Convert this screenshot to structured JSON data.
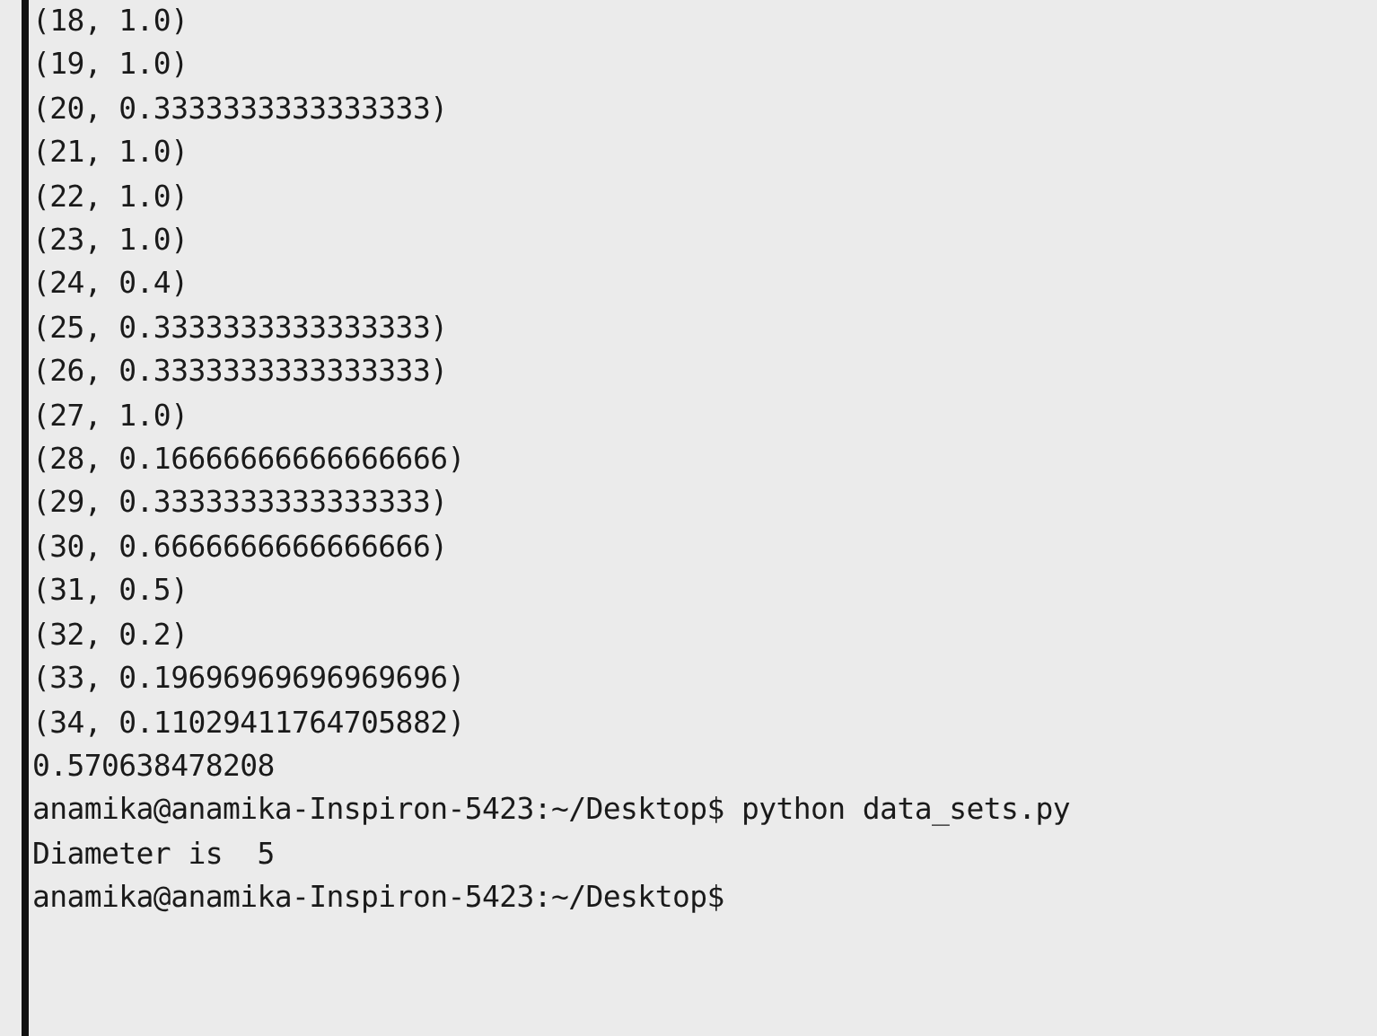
{
  "terminal": {
    "lines": [
      "(18, 1.0)",
      "(19, 1.0)",
      "(20, 0.3333333333333333)",
      "(21, 1.0)",
      "(22, 1.0)",
      "(23, 1.0)",
      "(24, 0.4)",
      "(25, 0.3333333333333333)",
      "(26, 0.3333333333333333)",
      "(27, 1.0)",
      "(28, 0.16666666666666666)",
      "(29, 0.3333333333333333)",
      "(30, 0.6666666666666666)",
      "(31, 0.5)",
      "(32, 0.2)",
      "(33, 0.19696969696969696)",
      "(34, 0.11029411764705882)",
      "0.570638478208",
      "anamika@anamika-Inspiron-5423:~/Desktop$ python data_sets.py",
      "Diameter is  5",
      "anamika@anamika-Inspiron-5423:~/Desktop$"
    ]
  }
}
